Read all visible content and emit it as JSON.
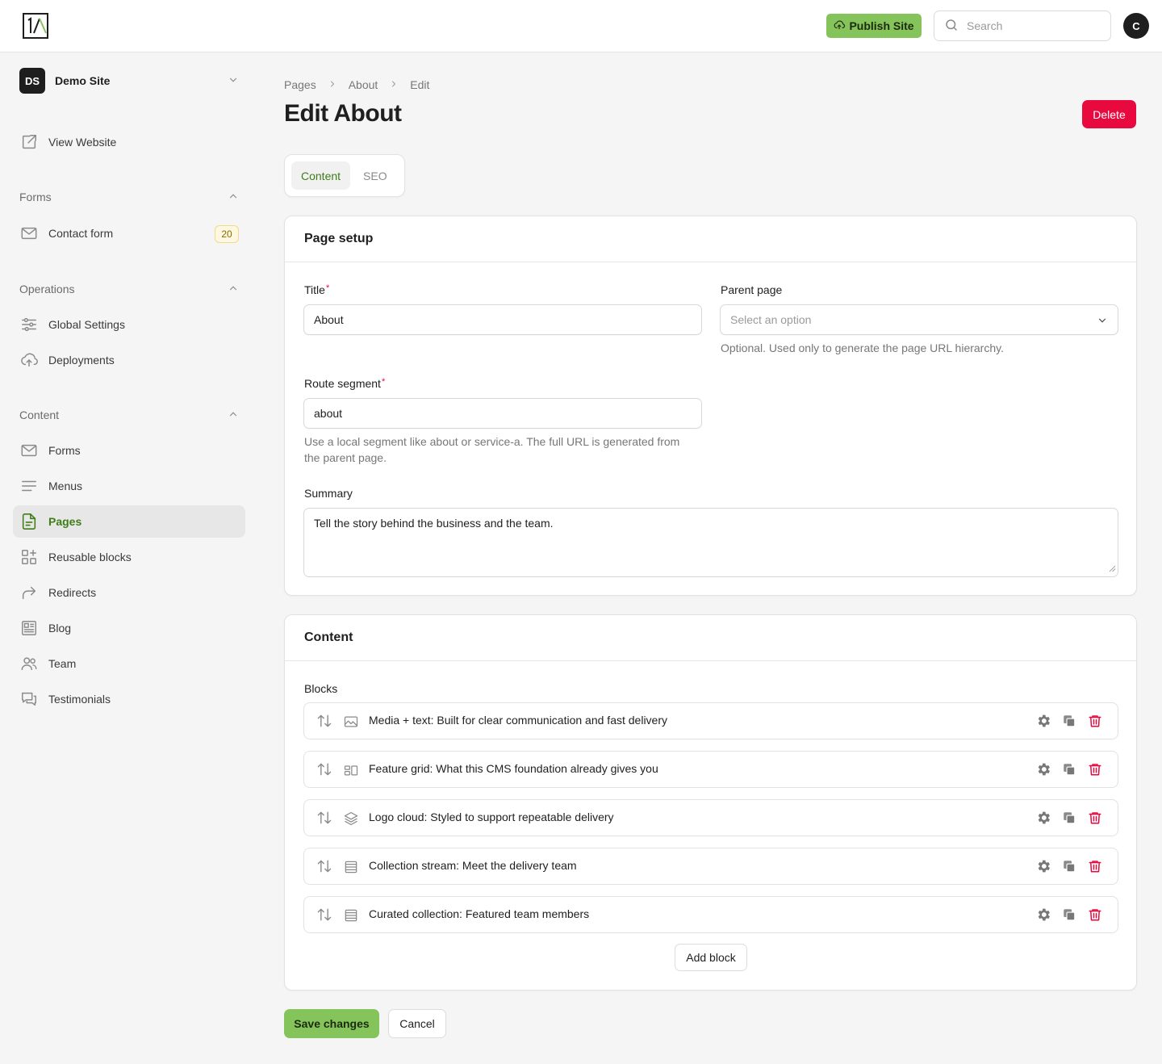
{
  "header": {
    "publish_label": "Publish Site",
    "search_placeholder": "Search",
    "avatar_initial": "C",
    "accent_color": "#84c45a"
  },
  "sidebar": {
    "site_badge": "DS",
    "site_name": "Demo Site",
    "view_website": "View Website",
    "groups": {
      "forms": "Forms",
      "operations": "Operations",
      "content": "Content"
    },
    "forms_items": [
      {
        "label": "Contact form",
        "icon": "mail-icon",
        "badge": "20"
      }
    ],
    "operations_items": [
      {
        "label": "Global Settings",
        "icon": "sliders-icon"
      },
      {
        "label": "Deployments",
        "icon": "cloud-upload-icon"
      }
    ],
    "content_items": [
      {
        "label": "Forms",
        "icon": "mail-icon"
      },
      {
        "label": "Menus",
        "icon": "menu-lines-icon"
      },
      {
        "label": "Pages",
        "icon": "file-text-icon",
        "active": true
      },
      {
        "label": "Reusable blocks",
        "icon": "blocks-icon"
      },
      {
        "label": "Redirects",
        "icon": "redirect-arrow-icon"
      },
      {
        "label": "Blog",
        "icon": "newspaper-icon"
      },
      {
        "label": "Team",
        "icon": "users-icon"
      },
      {
        "label": "Testimonials",
        "icon": "chat-bubbles-icon"
      }
    ]
  },
  "breadcrumb": [
    "Pages",
    "About",
    "Edit"
  ],
  "page_title": "Edit About",
  "delete_label": "Delete",
  "tabs": [
    {
      "label": "Content",
      "active": true
    },
    {
      "label": "SEO",
      "active": false
    }
  ],
  "page_setup": {
    "heading": "Page setup",
    "title_label": "Title",
    "title_value": "About",
    "parent_label": "Parent page",
    "parent_placeholder": "Select an option",
    "parent_help": "Optional. Used only to generate the page URL hierarchy.",
    "route_label": "Route segment",
    "route_value": "about",
    "route_help": "Use a local segment like about or service-a. The full URL is generated from the parent page.",
    "summary_label": "Summary",
    "summary_value": "Tell the story behind the business and the team.",
    "required_mark": "*"
  },
  "content_section": {
    "heading": "Content",
    "blocks_label": "Blocks",
    "blocks": [
      {
        "label": "Media + text: Built for clear communication and fast delivery",
        "icon": "image-icon"
      },
      {
        "label": "Feature grid: What this CMS foundation already gives you",
        "icon": "grid-icon"
      },
      {
        "label": "Logo cloud: Styled to support repeatable delivery",
        "icon": "layers-icon"
      },
      {
        "label": "Collection stream: Meet the delivery team",
        "icon": "list-icon"
      },
      {
        "label": "Curated collection: Featured team members",
        "icon": "list-icon"
      }
    ],
    "add_block_label": "Add block"
  },
  "footer": {
    "save_label": "Save changes",
    "cancel_label": "Cancel"
  }
}
